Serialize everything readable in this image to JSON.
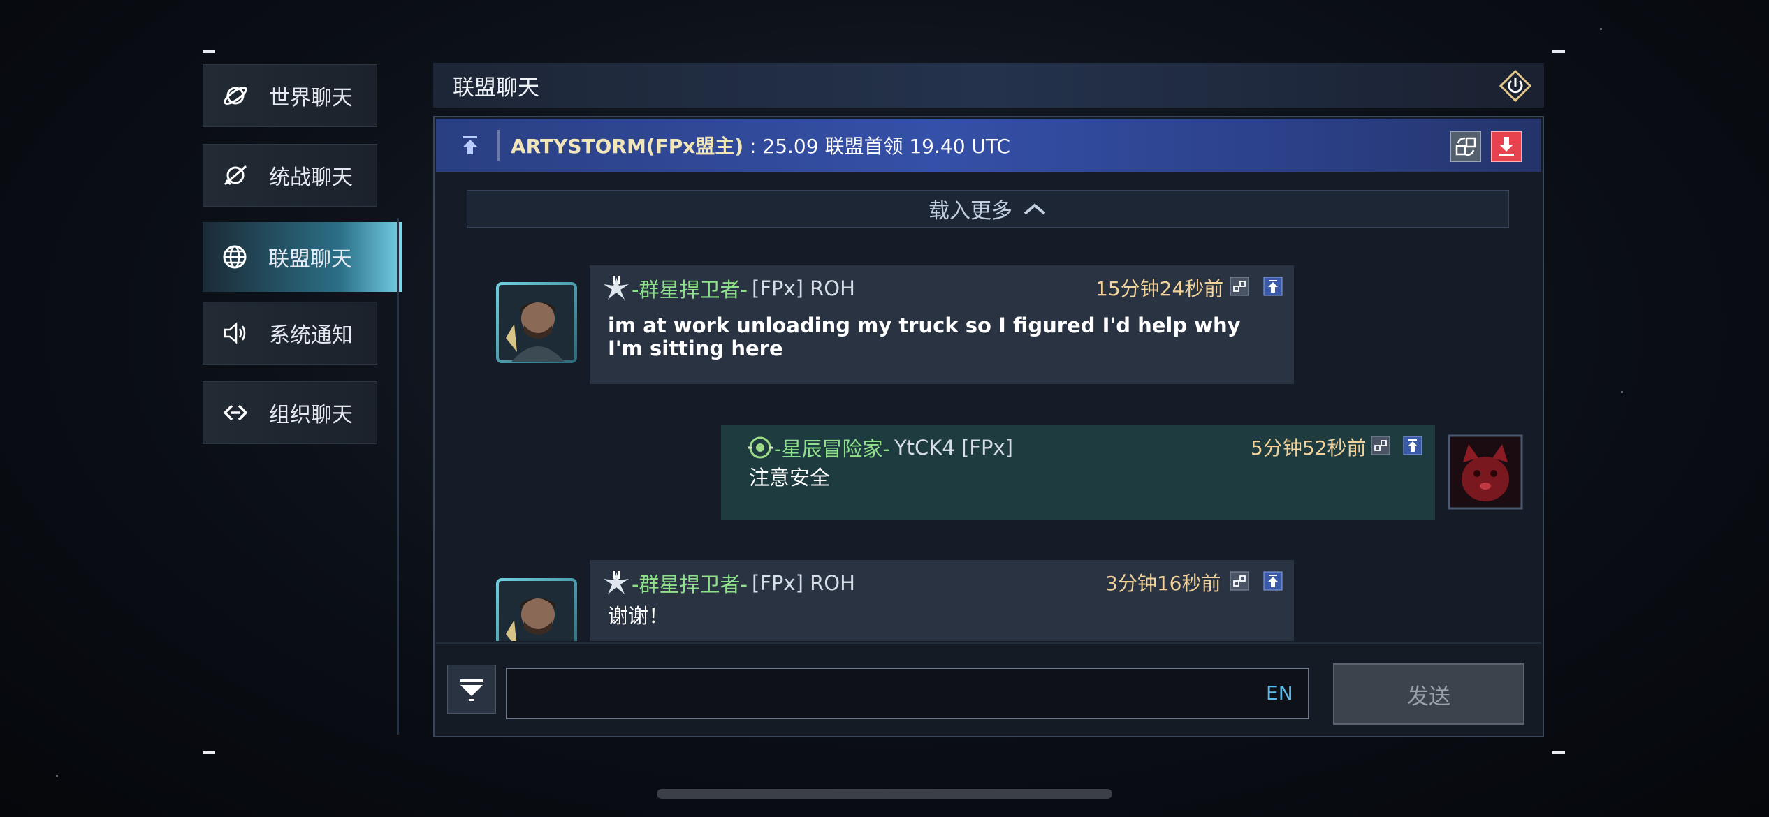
{
  "sidebar": {
    "items": [
      {
        "label": "世界聊天",
        "icon": "planet-icon"
      },
      {
        "label": "统战聊天",
        "icon": "planet-sword-icon"
      },
      {
        "label": "联盟聊天",
        "icon": "globe-icon"
      },
      {
        "label": "系统通知",
        "icon": "speaker-icon"
      },
      {
        "label": "组织聊天",
        "icon": "link-diamond-icon"
      }
    ],
    "active_index": 2
  },
  "panel": {
    "title": "联盟聊天",
    "exit_icon": "power-icon"
  },
  "pinned": {
    "author": "ARTYSTORM(FPx盟主)",
    "text": " : 25.09 联盟首领 19.40 UTC"
  },
  "load_more": {
    "label": "载入更多"
  },
  "messages": [
    {
      "side": "left",
      "rank": "-群星捍卫者-",
      "tag": "[FPx] ROH",
      "time": "15分钟24秒前",
      "text": "im at work unloading my truck so I figured I'd help why I'm sitting here"
    },
    {
      "side": "right",
      "rank": "-星辰冒险家-",
      "tag": "YtCK4 [FPx]",
      "time": "5分钟52秒前",
      "text": "注意安全"
    },
    {
      "side": "left",
      "rank": "-群星捍卫者-",
      "tag": "[FPx] ROH",
      "time": "3分钟16秒前",
      "text": "谢谢！"
    }
  ],
  "composer": {
    "value": "",
    "ime_label": "EN",
    "send_label": "发送"
  },
  "colors": {
    "accent": "#7fd6ea",
    "rank_green": "#8ee08a",
    "time_gold": "#f0d29a",
    "pinned_author": "#f2e6b8",
    "pin_delete": "#e6434e"
  }
}
